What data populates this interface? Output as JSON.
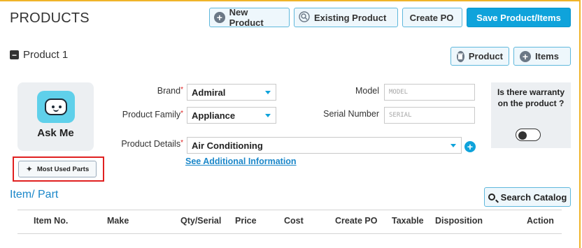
{
  "page": {
    "title": "PRODUCTS"
  },
  "header_buttons": {
    "new_product": "New Product",
    "existing_product": "Existing Product",
    "create_po": "Create PO",
    "save": "Save Product/Items"
  },
  "product_section": {
    "title": "Product 1",
    "product_btn": "Product",
    "items_btn": "Items"
  },
  "ask_me": {
    "label": "Ask Me",
    "most_used_parts": "Most Used Parts"
  },
  "form": {
    "brand_label": "Brand",
    "brand_value": "Admiral",
    "family_label": "Product Family",
    "family_value": "Appliance",
    "details_label": "Product Details",
    "details_value": "Air Conditioning",
    "model_label": "Model",
    "model_placeholder": "MODEL",
    "serial_label": "Serial Number",
    "serial_placeholder": "SERIAL",
    "additional_info": "See Additional Information",
    "required_mark": "*"
  },
  "warranty": {
    "question": "Is there warranty on the product ?",
    "enabled": false
  },
  "items": {
    "title": "Item/ Part",
    "search_catalog": "Search Catalog",
    "columns": [
      "Item No.",
      "Make",
      "Qty/Serial",
      "Price",
      "Cost",
      "Create PO",
      "Taxable",
      "Disposition",
      "Action"
    ]
  },
  "colors": {
    "accent": "#0fa3db",
    "link": "#1b87c9",
    "highlight": "#e02020",
    "frame": "#f0b429"
  }
}
